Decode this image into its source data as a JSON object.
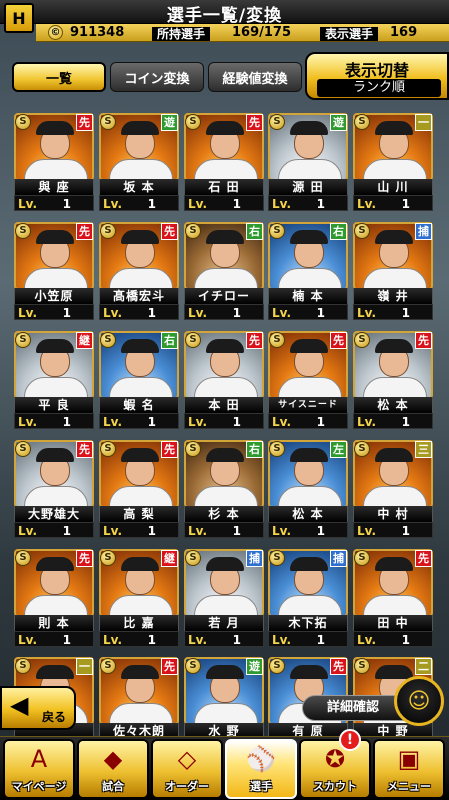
{
  "header": {
    "title": "選手一覧/変換",
    "logo_mark": "H",
    "coins": "911348",
    "owned_label": "所持選手",
    "owned_value": "169/175",
    "shown_label": "表示選手",
    "shown_value": "169"
  },
  "tabs": [
    {
      "label": "一覧",
      "active": true
    },
    {
      "label": "コイン変換",
      "active": false
    },
    {
      "label": "経験値変換",
      "active": false
    }
  ],
  "view_toggle": {
    "label": "表示切替",
    "mode": "ランク順"
  },
  "cards": [
    {
      "name": "與 座",
      "pos": "先",
      "pos_color": "#d8131b",
      "level_label": "Lv.",
      "level": "1",
      "bg": "orange"
    },
    {
      "name": "坂 本",
      "pos": "遊",
      "pos_color": "#2f9a2f",
      "level_label": "Lv.",
      "level": "1",
      "bg": "orange"
    },
    {
      "name": "石 田",
      "pos": "先",
      "pos_color": "#d8131b",
      "level_label": "Lv.",
      "level": "1",
      "bg": "orange"
    },
    {
      "name": "源 田",
      "pos": "遊",
      "pos_color": "#2f9a2f",
      "level_label": "Lv.",
      "level": "1",
      "bg": "silver"
    },
    {
      "name": "山 川",
      "pos": "一",
      "pos_color": "#a79a20",
      "level_label": "Lv.",
      "level": "1",
      "bg": "orange"
    },
    {
      "name": "小笠原",
      "pos": "先",
      "pos_color": "#d8131b",
      "level_label": "Lv.",
      "level": "1",
      "bg": "orange"
    },
    {
      "name": "髙橋宏斗",
      "pos": "先",
      "pos_color": "#d8131b",
      "level_label": "Lv.",
      "level": "1",
      "bg": "orange"
    },
    {
      "name": "イチロー",
      "pos": "右",
      "pos_color": "#2f9a2f",
      "level_label": "Lv.",
      "level": "1",
      "bg": "sepia"
    },
    {
      "name": "楠 本",
      "pos": "右",
      "pos_color": "#2f9a2f",
      "level_label": "Lv.",
      "level": "1",
      "bg": "blue"
    },
    {
      "name": "嶺 井",
      "pos": "捕",
      "pos_color": "#2f6fd0",
      "level_label": "Lv.",
      "level": "1",
      "bg": "orange"
    },
    {
      "name": "平 良",
      "pos": "継",
      "pos_color": "#d8131b",
      "level_label": "Lv.",
      "level": "1",
      "bg": "silver"
    },
    {
      "name": "蝦 名",
      "pos": "右",
      "pos_color": "#2f9a2f",
      "level_label": "Lv.",
      "level": "1",
      "bg": "blue"
    },
    {
      "name": "本 田",
      "pos": "先",
      "pos_color": "#d8131b",
      "level_label": "Lv.",
      "level": "1",
      "bg": "silver"
    },
    {
      "name": "サイスニード",
      "pos": "先",
      "pos_color": "#d8131b",
      "level_label": "Lv.",
      "level": "1",
      "bg": "orange"
    },
    {
      "name": "松 本",
      "pos": "先",
      "pos_color": "#d8131b",
      "level_label": "Lv.",
      "level": "1",
      "bg": "silver"
    },
    {
      "name": "大野雄大",
      "pos": "先",
      "pos_color": "#d8131b",
      "level_label": "Lv.",
      "level": "1",
      "bg": "silver"
    },
    {
      "name": "高 梨",
      "pos": "先",
      "pos_color": "#d8131b",
      "level_label": "Lv.",
      "level": "1",
      "bg": "orange"
    },
    {
      "name": "杉 本",
      "pos": "右",
      "pos_color": "#2f9a2f",
      "level_label": "Lv.",
      "level": "1",
      "bg": "sepia"
    },
    {
      "name": "松 本",
      "pos": "左",
      "pos_color": "#2f9a2f",
      "level_label": "Lv.",
      "level": "1",
      "bg": "blue"
    },
    {
      "name": "中 村",
      "pos": "三",
      "pos_color": "#a79a20",
      "level_label": "Lv.",
      "level": "1",
      "bg": "orange"
    },
    {
      "name": "則 本",
      "pos": "先",
      "pos_color": "#d8131b",
      "level_label": "Lv.",
      "level": "1",
      "bg": "orange"
    },
    {
      "name": "比 嘉",
      "pos": "継",
      "pos_color": "#d8131b",
      "level_label": "Lv.",
      "level": "1",
      "bg": "orange"
    },
    {
      "name": "若 月",
      "pos": "捕",
      "pos_color": "#2f6fd0",
      "level_label": "Lv.",
      "level": "1",
      "bg": "silver"
    },
    {
      "name": "木下拓",
      "pos": "捕",
      "pos_color": "#2f6fd0",
      "level_label": "Lv.",
      "level": "1",
      "bg": "blue"
    },
    {
      "name": "田 中",
      "pos": "先",
      "pos_color": "#d8131b",
      "level_label": "Lv.",
      "level": "1",
      "bg": "orange"
    },
    {
      "name": "",
      "pos": "一",
      "pos_color": "#a79a20",
      "level_label": "",
      "level": "",
      "bg": "orange"
    },
    {
      "name": "佐々木朗",
      "pos": "先",
      "pos_color": "#d8131b",
      "level_label": "",
      "level": "",
      "bg": "orange"
    },
    {
      "name": "水 野",
      "pos": "遊",
      "pos_color": "#2f9a2f",
      "level_label": "",
      "level": "",
      "bg": "blue"
    },
    {
      "name": "有 原",
      "pos": "先",
      "pos_color": "#d8131b",
      "level_label": "",
      "level": "",
      "bg": "blue"
    },
    {
      "name": "中 野",
      "pos": "二",
      "pos_color": "#a79a20",
      "level_label": "",
      "level": "",
      "bg": "orange"
    }
  ],
  "overlay": {
    "back_label": "戻る",
    "detail_label": "詳細確認"
  },
  "bottom_nav": [
    {
      "label": "マイページ",
      "icon": "A",
      "active": false
    },
    {
      "label": "試合",
      "icon": "◆",
      "active": false
    },
    {
      "label": "オーダー",
      "icon": "◇",
      "active": false
    },
    {
      "label": "選手",
      "icon": "⚾",
      "active": true
    },
    {
      "label": "スカウト",
      "icon": "✪",
      "active": false
    },
    {
      "label": "メニュー",
      "icon": "▣",
      "active": false
    }
  ],
  "scout_alert": "!"
}
